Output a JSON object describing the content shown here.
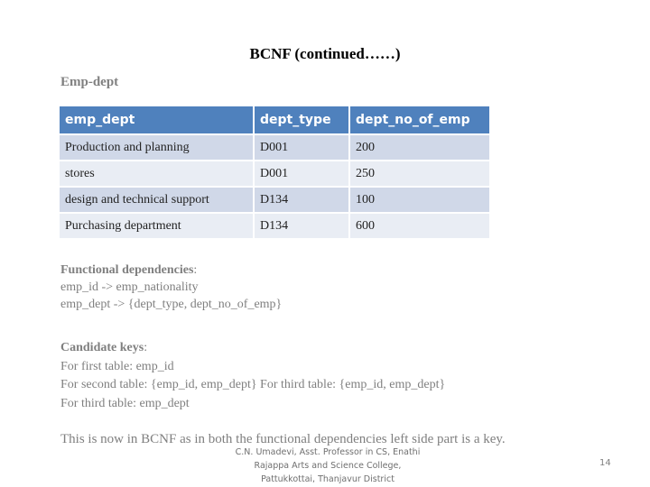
{
  "slide": {
    "title": "BCNF (continued……)",
    "subtitle": "Emp-dept",
    "page_number": "14"
  },
  "table": {
    "headers": [
      "emp_dept",
      "dept_type",
      "dept_no_of_emp"
    ],
    "rows": [
      [
        "Production and planning",
        "D001",
        "200"
      ],
      [
        "stores",
        "D001",
        "250"
      ],
      [
        "design and technical support",
        "D134",
        "100"
      ],
      [
        "Purchasing department",
        "D134",
        "600"
      ]
    ],
    "colors": {
      "header_bg": "#4f81bd",
      "row_odd_bg": "#d0d8e8",
      "row_even_bg": "#e9edf4"
    }
  },
  "functional_dependencies": {
    "heading": "Functional dependencies",
    "colon": ":",
    "lines": [
      "emp_id -> emp_nationality",
      "emp_dept -> {dept_type, dept_no_of_emp}"
    ]
  },
  "candidate_keys": {
    "heading": "Candidate keys",
    "colon": ":",
    "lines": [
      "For first table: emp_id",
      "For second table: {emp_id, emp_dept} For third table: {emp_id, emp_dept}",
      "For third table: emp_dept"
    ]
  },
  "conclusion": "This is now in BCNF as in both the functional dependencies left side part is a key.",
  "footer": {
    "lines": [
      "C.N. Umadevi, Asst. Professor in CS, Enathi",
      "Rajappa Arts and Science College,",
      "Pattukkottai, Thanjavur District"
    ]
  }
}
